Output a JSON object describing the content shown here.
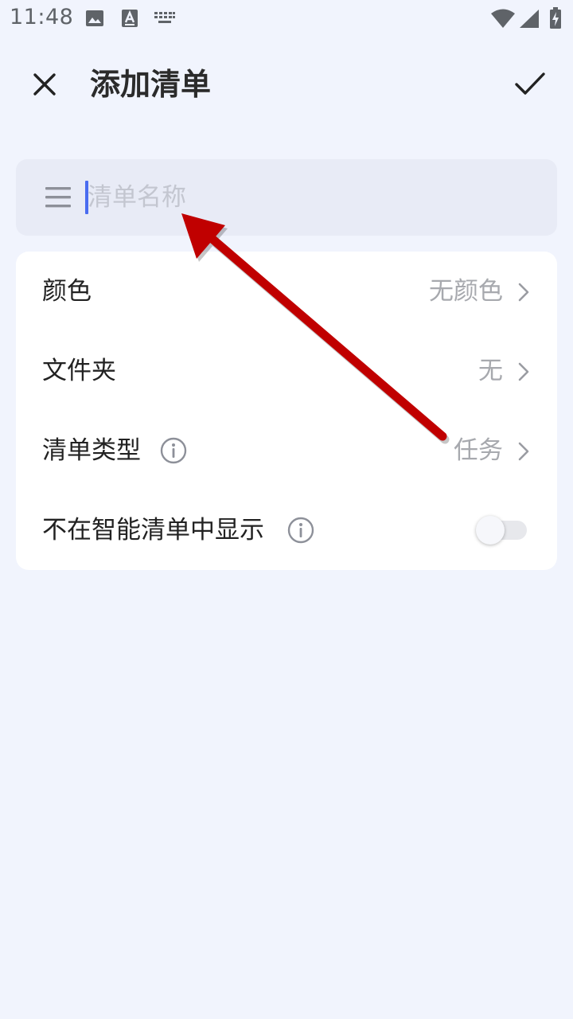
{
  "status_bar": {
    "time": "11:48",
    "left_icons": [
      "image-icon",
      "text-a-icon",
      "keyboard-icon"
    ],
    "right_icons": [
      "wifi-icon",
      "signal-icon",
      "battery-charging-icon"
    ]
  },
  "header": {
    "title": "添加清单",
    "close_icon": "close-icon",
    "confirm_icon": "check-icon"
  },
  "name_field": {
    "value": "",
    "placeholder": "清单名称",
    "icon": "list-icon"
  },
  "settings": {
    "color": {
      "label": "颜色",
      "value": "无颜色"
    },
    "folder": {
      "label": "文件夹",
      "value": "无"
    },
    "list_type": {
      "label": "清单类型",
      "value": "任务"
    },
    "smart_list": {
      "label": "不在智能清单中显示",
      "enabled": false
    }
  },
  "annotation": {
    "type": "arrow",
    "color": "#c00000"
  },
  "colors": {
    "background": "#f1f4fd",
    "card": "#ffffff",
    "input_bg": "#e8ebf6",
    "caret": "#4a6cf0",
    "value_text": "#a7a9ae"
  }
}
